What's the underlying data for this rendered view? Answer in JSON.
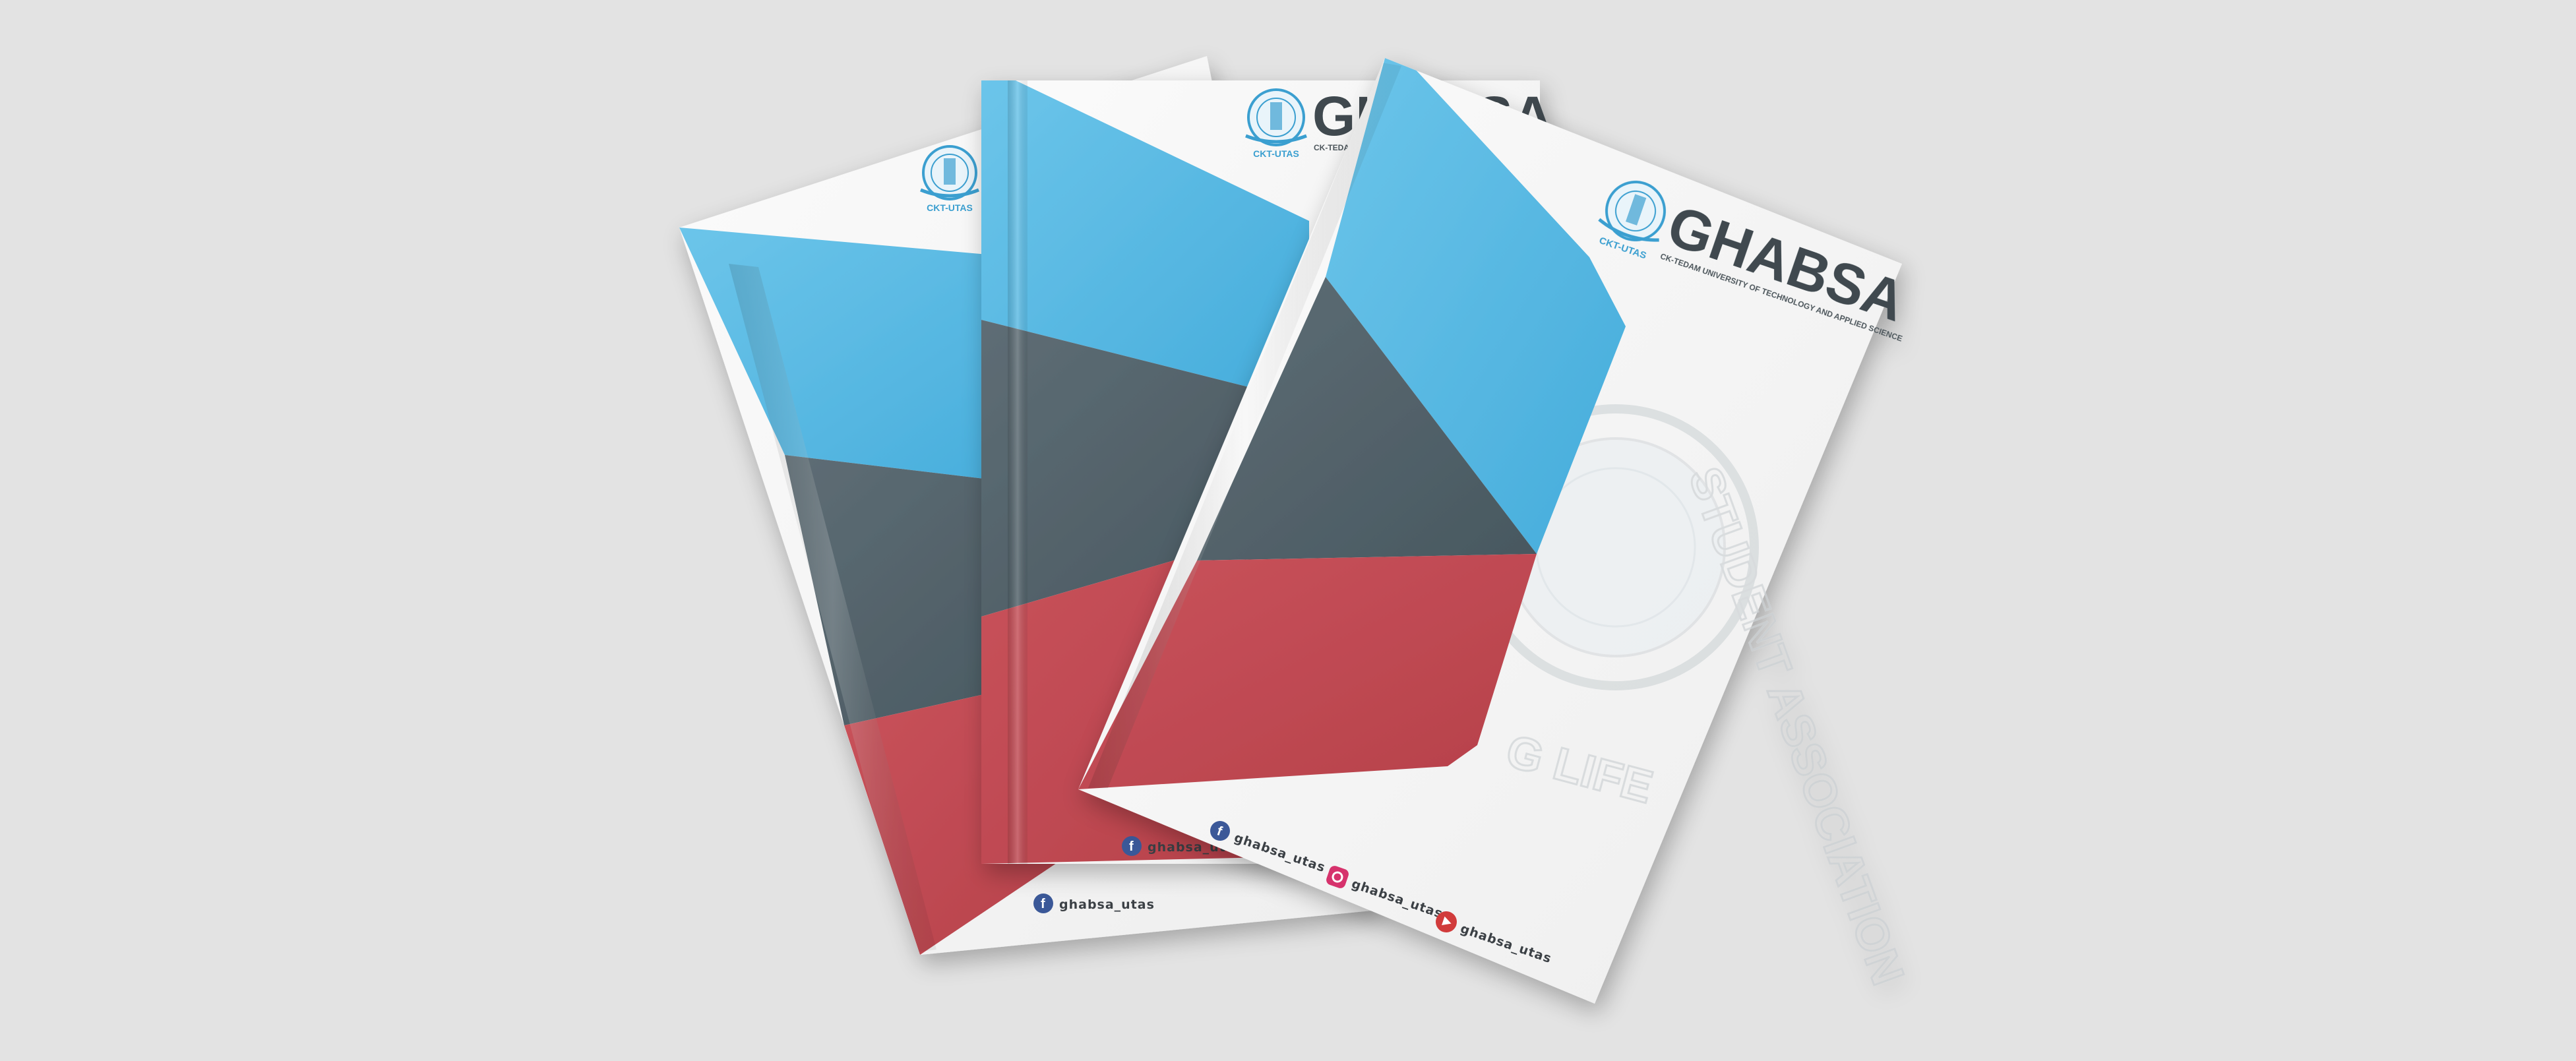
{
  "brand": {
    "name": "GHABSA",
    "name_partial": "GHABSA",
    "tagline": "CK-TEDAM UNIVERSITY OF TECHNOLOGY AND APPLIED SCIENCE",
    "tagline_partial": "CK-TEDA",
    "seal_label": "CKT-UTAS"
  },
  "watermark": {
    "ring_text": "STUDENT ASSOCIATION",
    "motto_text": "G LIFE"
  },
  "social": [
    {
      "platform": "facebook",
      "icon": "facebook-icon",
      "handle": "ghabsa_utas"
    },
    {
      "platform": "instagram",
      "icon": "instagram-icon",
      "handle": "ghabsa_utas"
    },
    {
      "platform": "youtube",
      "icon": "youtube-icon",
      "handle": "ghabsa_utas"
    }
  ],
  "colors": {
    "background": "#e3e3e3",
    "paper": "#f7f7f7",
    "blue": "#4eb6e2",
    "slate": "#4e5d66",
    "red": "#c0474f",
    "text_dark": "#3f4a50",
    "seal_blue": "#3a9fd0"
  }
}
